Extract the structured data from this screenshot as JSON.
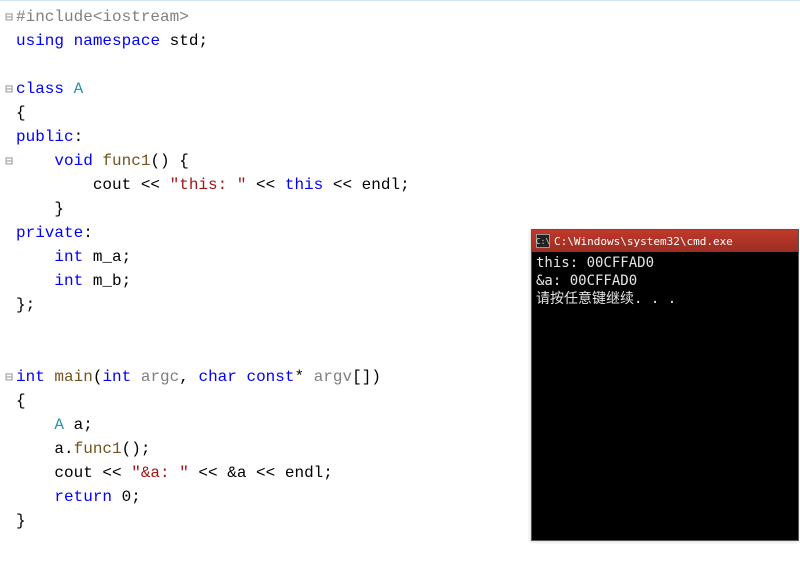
{
  "code": {
    "l1_preproc_include": "#include",
    "l1_preproc_header": "<iostream>",
    "l2_using": "using",
    "l2_namespace": "namespace",
    "l2_std": "std",
    "l2_semi": ";",
    "l4_class": "class",
    "l4_A": "A",
    "l5_openbrace": "{",
    "l6_public": "public",
    "l6_colon": ":",
    "l7_void": "void",
    "l7_func1": "func1",
    "l7_parens": "()",
    "l7_openbrace": " {",
    "l8_cout": "cout",
    "l8_ins1": " << ",
    "l8_str": "\"this: \"",
    "l8_ins2": " << ",
    "l8_this": "this",
    "l8_ins3": " << ",
    "l8_endl": "endl",
    "l8_semi": ";",
    "l9_closebrace": "}",
    "l10_private": "private",
    "l10_colon": ":",
    "l11_int": "int",
    "l11_ma": " m_a",
    "l11_semi": ";",
    "l12_int": "int",
    "l12_mb": " m_b",
    "l12_semi": ";",
    "l13_close": "};",
    "l16_int": "int",
    "l16_main": " main",
    "l16_open": "(",
    "l16_int2": "int",
    "l16_argc": " argc",
    "l16_comma": ", ",
    "l16_char": "char",
    "l16_const": " const",
    "l16_star": "*",
    "l16_argv": " argv",
    "l16_brackets": "[]",
    "l16_close": ")",
    "l17_open": "{",
    "l18_A": "A",
    "l18_a": " a",
    "l18_semi": ";",
    "l19_a": "a",
    "l19_dot": ".",
    "l19_func1": "func1",
    "l19_parens": "()",
    "l19_semi": ";",
    "l20_cout": "cout",
    "l20_ins1": " << ",
    "l20_str": "\"&a: \"",
    "l20_ins2": " << ",
    "l20_amp": "&",
    "l20_a": "a",
    "l20_ins3": " << ",
    "l20_endl": "endl",
    "l20_semi": ";",
    "l21_return": "return",
    "l21_zero": " 0",
    "l21_semi": ";",
    "l22_close": "}"
  },
  "gutter": {
    "fold": "⊟"
  },
  "console": {
    "title_icon": "C:\\",
    "title": "C:\\Windows\\system32\\cmd.exe",
    "line1": "this: 00CFFAD0",
    "line2": "&a: 00CFFAD0",
    "line3": "请按任意键继续. . ."
  }
}
